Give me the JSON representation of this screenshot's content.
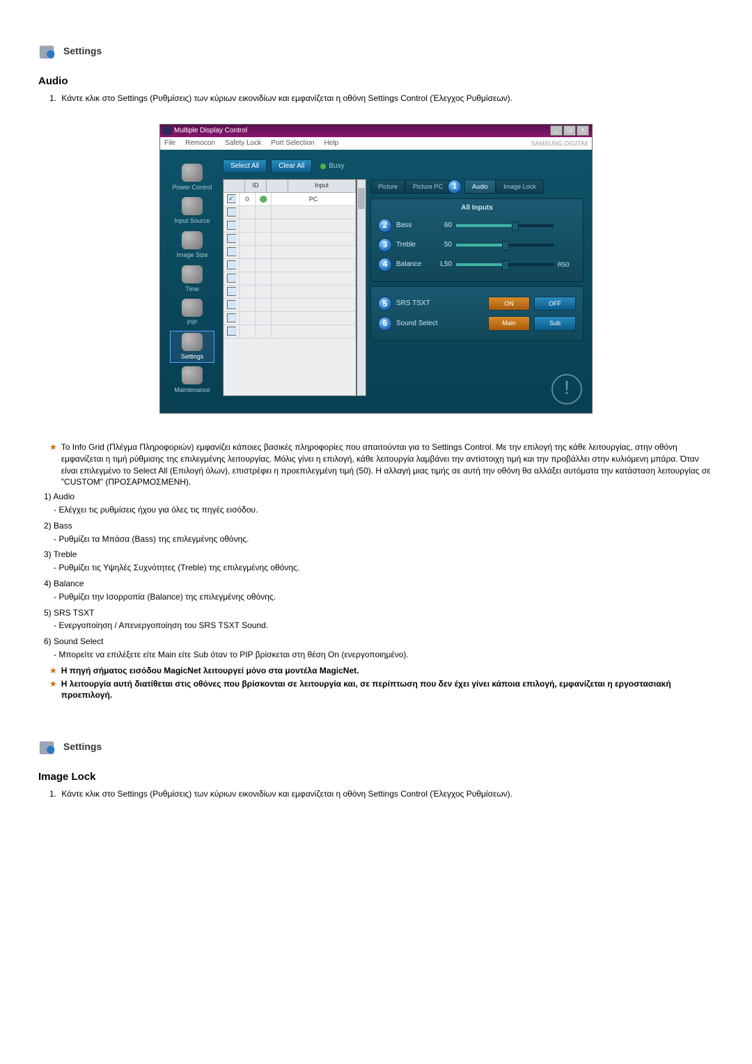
{
  "section1": {
    "title": "Settings",
    "subtitle": "Audio",
    "step_num": "1.",
    "step_text": "Κάντε κλικ στο Settings (Ρυθμίσεις) των κύριων εικονιδίων και εμφανίζεται η οθόνη Settings Control (Έλεγχος Ρυθμίσεων)."
  },
  "app": {
    "title": "Multiple Display Control",
    "menu": [
      "File",
      "Remocon",
      "Safety Lock",
      "Port Selection",
      "Help"
    ],
    "brand": "SAMSUNG DIGITAll",
    "sidebar": [
      {
        "label": "Power Control"
      },
      {
        "label": "Input Source"
      },
      {
        "label": "Image Size"
      },
      {
        "label": "Time"
      },
      {
        "label": "PIP"
      },
      {
        "label": "Settings"
      },
      {
        "label": "Maintenance"
      }
    ],
    "select_all": "Select All",
    "clear_all": "Clear All",
    "busy": "Busy",
    "grid_headers": {
      "cb": "",
      "id": "ID",
      "stat": "",
      "input": "Input"
    },
    "grid_row": {
      "id": "0",
      "input": "PC"
    },
    "tabs": [
      "Picture",
      "Picture PC",
      "Audio",
      "Image Lock"
    ],
    "panel_title": "All Inputs",
    "sliders": [
      {
        "num": "2",
        "label": "Bass",
        "val": "60",
        "pct": 60,
        "endL": "",
        "endR": ""
      },
      {
        "num": "3",
        "label": "Treble",
        "val": "50",
        "pct": 50,
        "endL": "",
        "endR": ""
      },
      {
        "num": "4",
        "label": "Balance",
        "val": "L50",
        "pct": 50,
        "endL": "",
        "endR": "R50"
      }
    ],
    "toggles": [
      {
        "num": "5",
        "label": "SRS TSXT",
        "a": "ON",
        "b": "OFF"
      },
      {
        "num": "6",
        "label": "Sound Select",
        "a": "Main",
        "b": "Sub"
      }
    ],
    "audio_badge": "1"
  },
  "notes": {
    "star1": "Το Info Grid (Πλέγμα Πληροφοριών) εμφανίζει κάποιες βασικές πληροφορίες που απαιτούνται για το Settings Control. Με την επιλογή της κάθε λειτουργίας, στην οθόνη εμφανίζεται η τιμή ρύθμισης της επιλεγμένης λειτουργίας. Μόλις γίνει η επιλογή, κάθε λειτουργία λαμβάνει την αντίστοιχη τιμή και την προβάλλει στην κυλιόμενη μπάρα. Όταν είναι επιλεγμένο το Select All (Επιλογή όλων), επιστρέφει η προεπιλεγμένη τιμή (50). Η αλλαγή μιας τιμής σε αυτή την οθόνη θα αλλάξει αυτόματα την κατάσταση λειτουργίας σε \"CUSTOM\" (ΠΡΟΣΑΡΜΟΣΜΕΝΗ).",
    "items": [
      {
        "num": "1)",
        "title": "Audio",
        "desc": "- Ελέγχει τις ρυθμίσεις ήχου για όλες τις πηγές εισόδου."
      },
      {
        "num": "2)",
        "title": "Bass",
        "desc": "- Ρυθμίζει τα Μπάσα (Bass) της επιλεγμένης οθόνης."
      },
      {
        "num": "3)",
        "title": "Treble",
        "desc": "- Ρυθμίζει τις Υψηλές Συχνότητες (Treble) της επιλεγμένης οθόνης."
      },
      {
        "num": "4)",
        "title": "Balance",
        "desc": "- Ρυθμίζει την Ισορροπία (Balance) της επιλεγμένης οθόνης."
      },
      {
        "num": "5)",
        "title": "SRS TSXT",
        "desc": "- Ενεργοποίηση / Απενεργοποίηση του SRS TSXT Sound."
      },
      {
        "num": "6)",
        "title": "Sound Select",
        "desc": "- Μπορείτε να επιλέξετε είτε Main είτε Sub όταν το PIP βρίσκεται στη θέση On (ενεργοποιημένο)."
      }
    ],
    "star2": "Η πηγή σήματος εισόδου MagicNet λειτουργεί μόνο στα μοντέλα MagicNet.",
    "star3": "Η λειτουργία αυτή διατίθεται στις οθόνες που βρίσκονται σε λειτουργία και, σε περίπτωση που δεν έχει γίνει κάποια επιλογή, εμφανίζεται η εργοστασιακή προεπιλογή."
  },
  "section2": {
    "title": "Settings",
    "subtitle": "Image Lock",
    "step_num": "1.",
    "step_text": "Κάντε κλικ στο Settings (Ρυθμίσεις) των κύριων εικονιδίων και εμφανίζεται η οθόνη Settings Control (Έλεγχος Ρυθμίσεων)."
  }
}
